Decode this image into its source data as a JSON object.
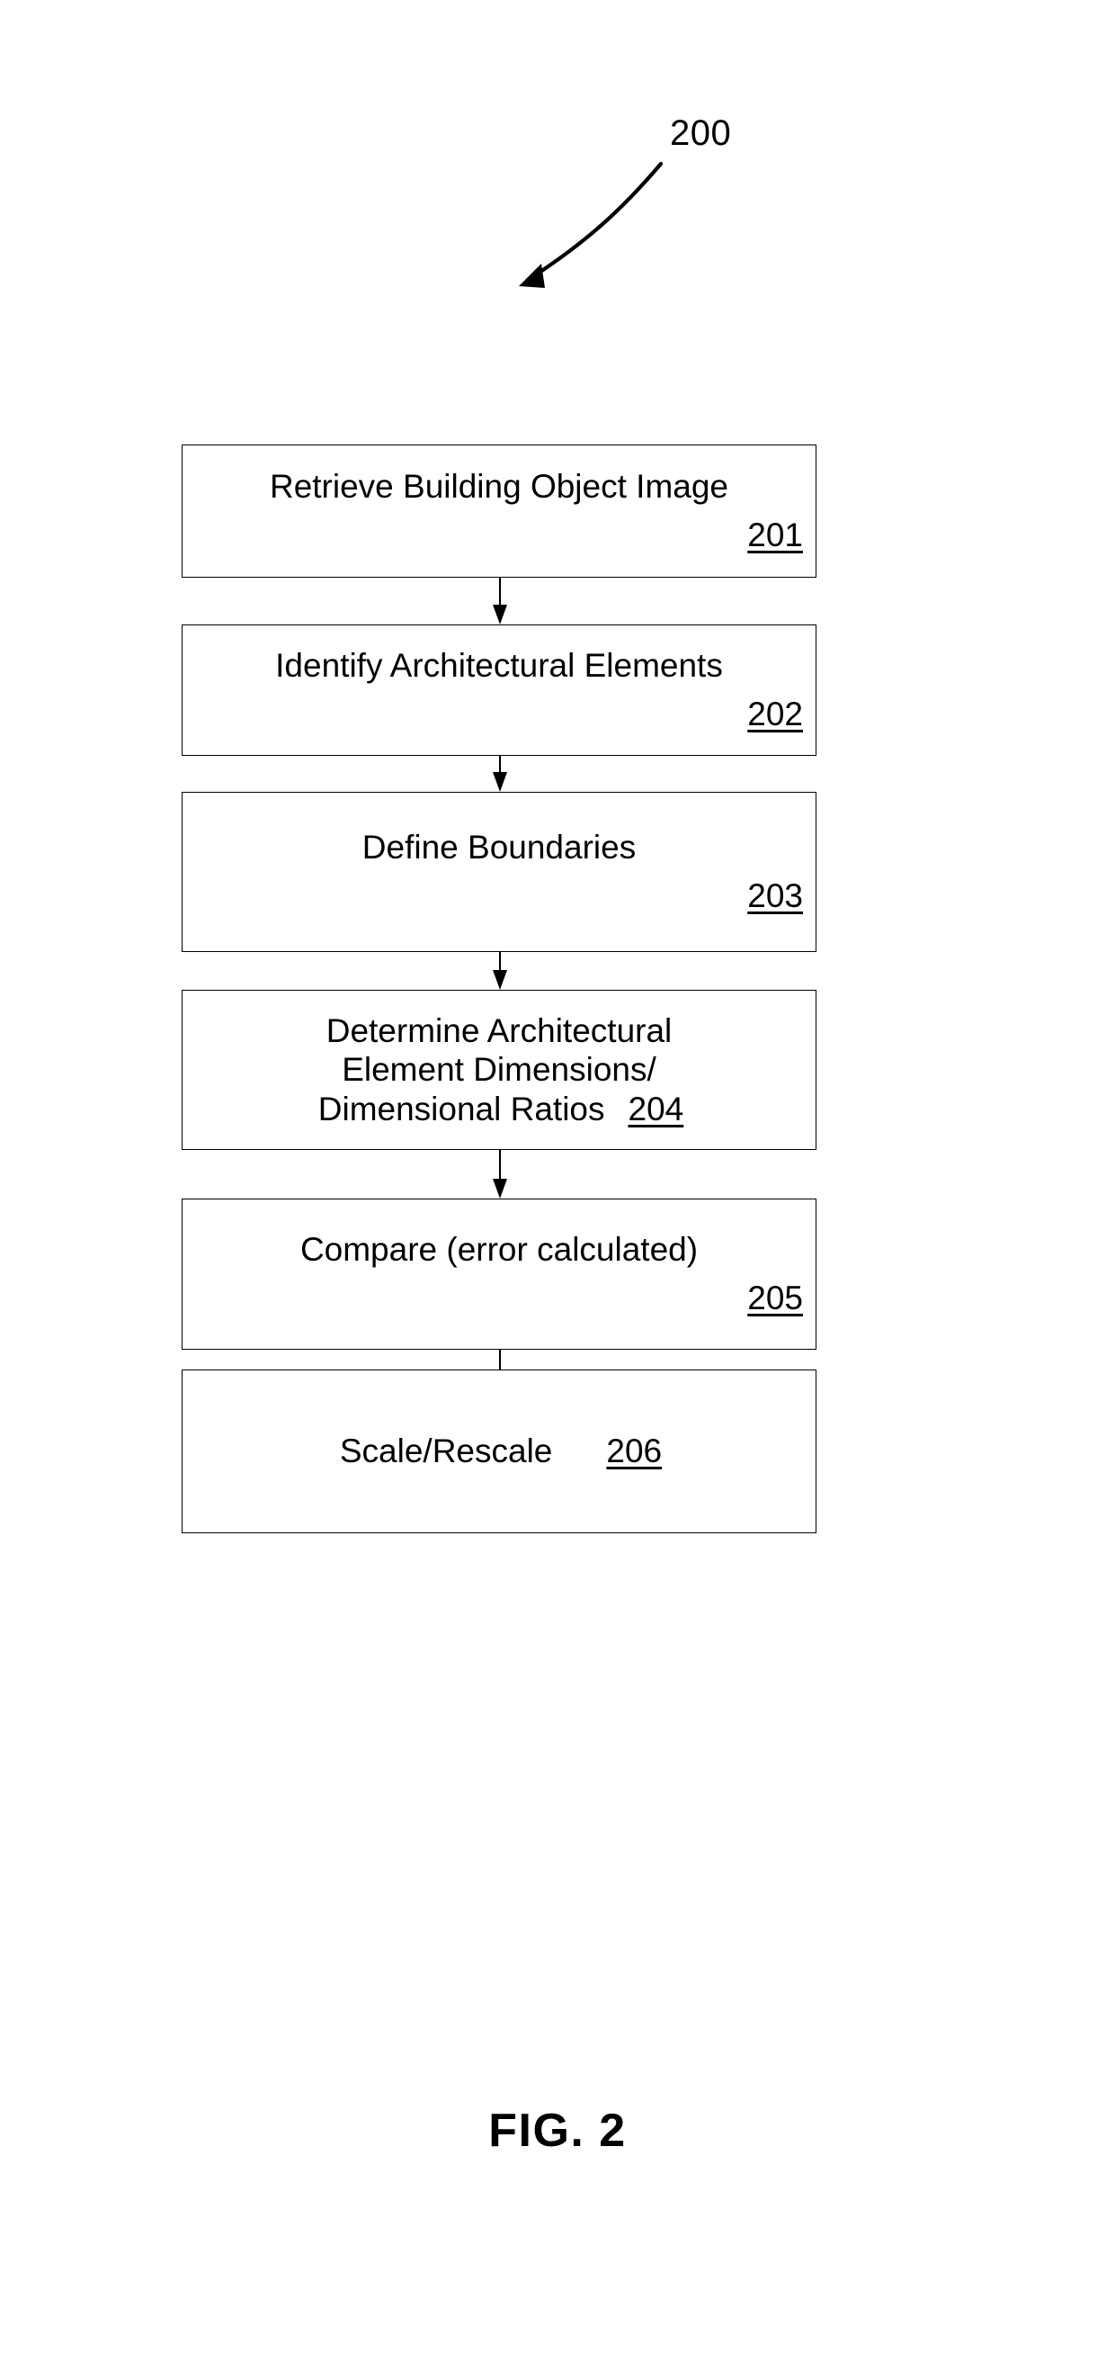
{
  "figure": {
    "caption": "FIG. 2",
    "diagram_reference_numeral": "200",
    "type": "patent-flowchart",
    "orientation": "vertical-top-to-bottom",
    "steps": [
      {
        "id": "201",
        "label": "Retrieve Building Object Image",
        "numeral": "201",
        "lines": [
          "Retrieve Building Object Image"
        ],
        "numeral_placement": "own-line-right"
      },
      {
        "id": "202",
        "label": "Identify Architectural Elements",
        "numeral": "202",
        "lines": [
          "Identify Architectural Elements"
        ],
        "numeral_placement": "own-line-right"
      },
      {
        "id": "203",
        "label": "Define Boundaries",
        "numeral": "203",
        "lines": [
          "Define Boundaries"
        ],
        "numeral_placement": "own-line-right"
      },
      {
        "id": "204",
        "label": "Determine Architectural Element Dimensions/ Dimensional Ratios",
        "numeral": "204",
        "lines": [
          "Determine Architectural",
          "Element Dimensions/",
          "Dimensional Ratios"
        ],
        "numeral_placement": "inline-last-line"
      },
      {
        "id": "205",
        "label": "Compare (error calculated)",
        "numeral": "205",
        "lines": [
          "Compare (error calculated)"
        ],
        "numeral_placement": "own-line-right"
      },
      {
        "id": "206",
        "label": "Scale/Rescale",
        "numeral": "206",
        "lines": [
          "Scale/Rescale"
        ],
        "numeral_placement": "inline-last-line"
      }
    ],
    "connectors": [
      {
        "from": "201",
        "to": "202",
        "arrow": "down"
      },
      {
        "from": "202",
        "to": "203",
        "arrow": "down"
      },
      {
        "from": "203",
        "to": "204",
        "arrow": "down"
      },
      {
        "from": "204",
        "to": "205",
        "arrow": "down"
      },
      {
        "from": "205",
        "to": "206",
        "arrow": "down"
      }
    ],
    "colors": {
      "background": "#ffffff",
      "ink": "#000000",
      "box_border": "#000000"
    }
  }
}
